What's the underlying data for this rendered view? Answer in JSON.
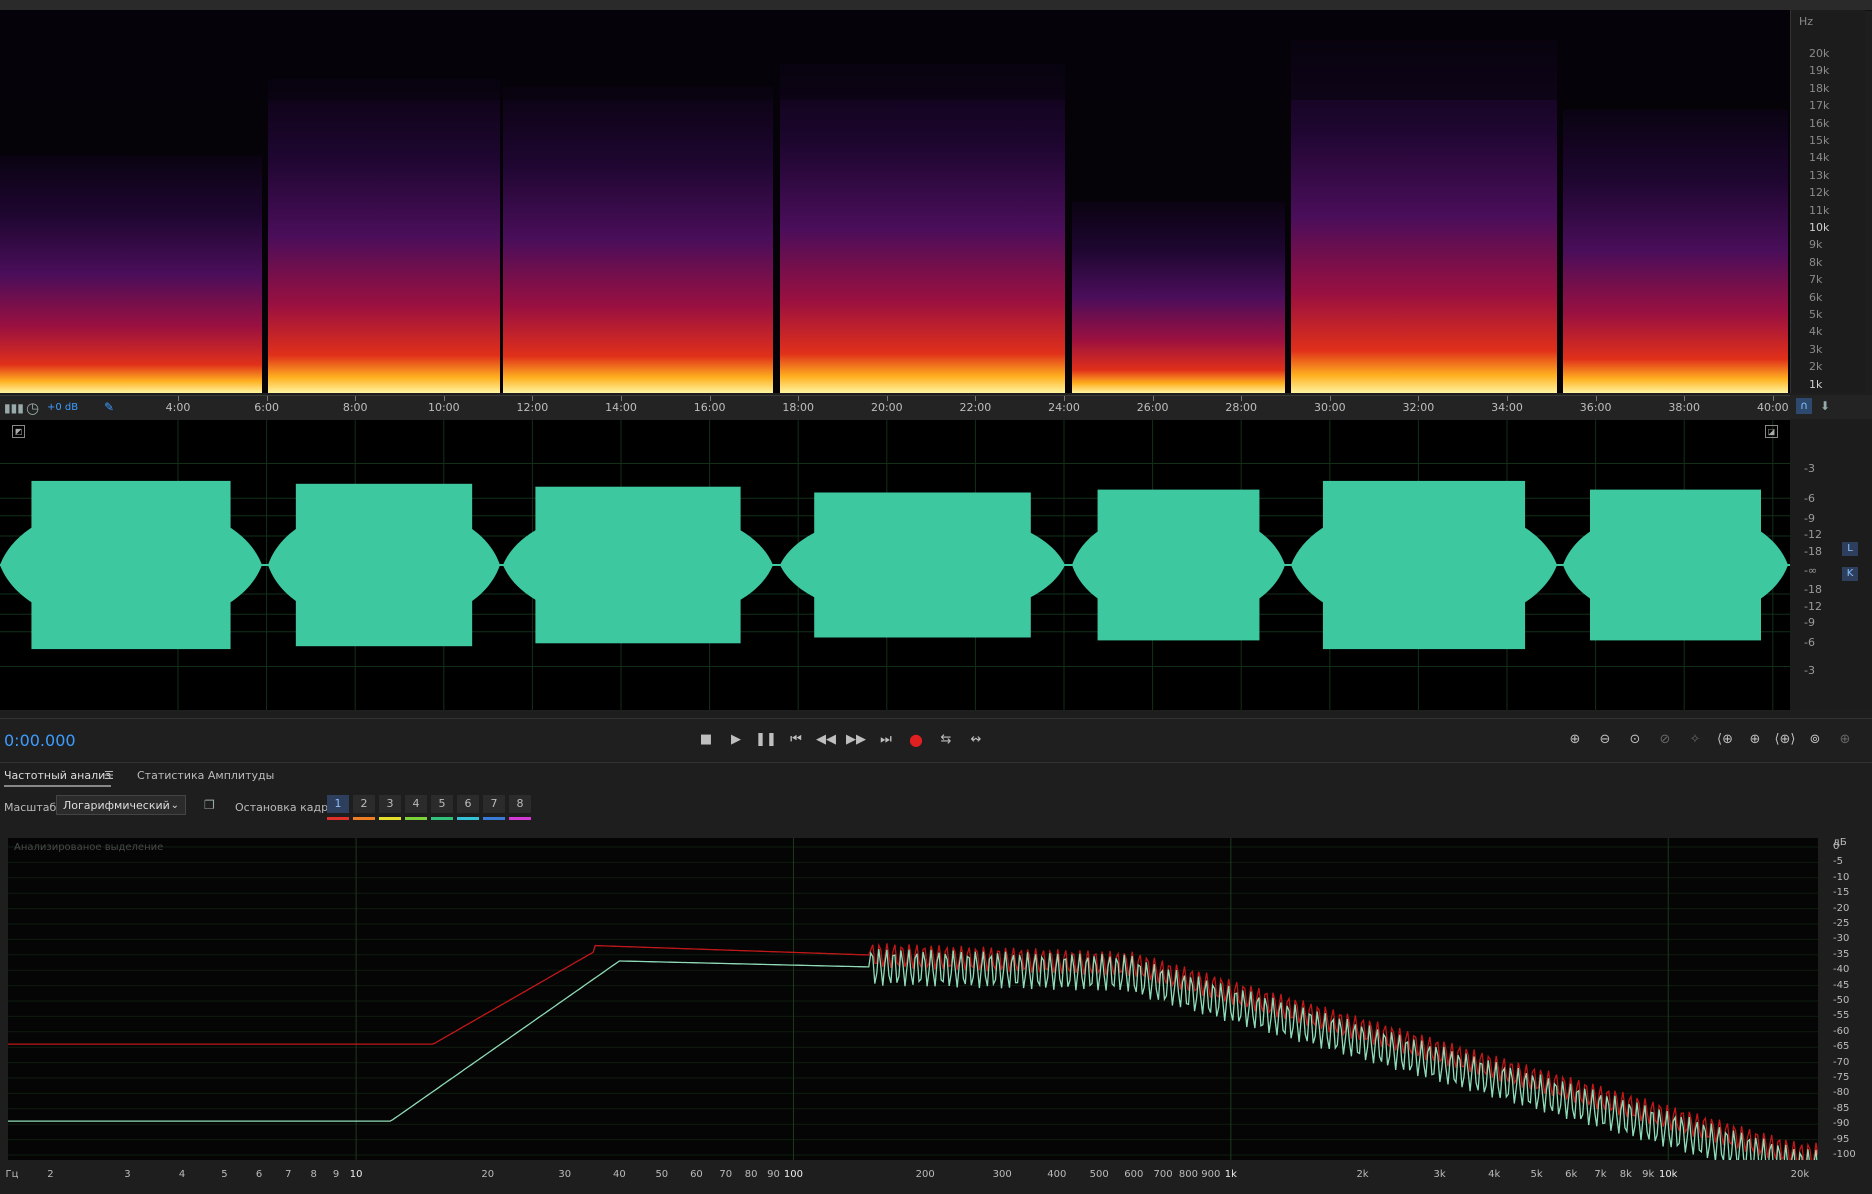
{
  "spectral_scale": {
    "unit": "Hz",
    "ticks": [
      "20k",
      "19k",
      "18k",
      "17k",
      "16k",
      "15k",
      "14k",
      "13k",
      "12k",
      "11k",
      "10k",
      "9k",
      "8k",
      "7k",
      "6k",
      "5k",
      "4k",
      "3k",
      "2k",
      "1k"
    ]
  },
  "timeline": {
    "gain_label": "+0 dB",
    "labels": [
      "4:00",
      "6:00",
      "8:00",
      "10:00",
      "12:00",
      "14:00",
      "16:00",
      "18:00",
      "20:00",
      "22:00",
      "24:00",
      "26:00",
      "28:00",
      "30:00",
      "32:00",
      "34:00",
      "36:00",
      "38:00",
      "40:00"
    ]
  },
  "waveform_scale": {
    "top": [
      "-3",
      "-6",
      "-9",
      "-12",
      "-18"
    ],
    "center": "-∞",
    "bottom": [
      "-18",
      "-12",
      "-9",
      "-6",
      "-3"
    ],
    "channel_top": "L",
    "channel_bottom": "K"
  },
  "transport": {
    "time": "0:00.000"
  },
  "panel": {
    "tab_frequency": "Частотный анализ",
    "tab_amplitude": "Статистика Амплитуды",
    "scale_label": "Масштаб:",
    "scale_value": "Логарифмический",
    "freeze_label": "Остановка кадра:",
    "frames": [
      "1",
      "2",
      "3",
      "4",
      "5",
      "6",
      "7",
      "8"
    ],
    "frame_colors": [
      "#e0302a",
      "#ef7d22",
      "#e6df2c",
      "#7cd43a",
      "#33c27a",
      "#35c2d6",
      "#3a7bd8",
      "#d63ad6"
    ],
    "plot_caption": "Анализированое выделение"
  },
  "freq_axis": {
    "unit": "Гц",
    "labels": [
      "2",
      "3",
      "4",
      "5",
      "6",
      "7",
      "8",
      "9",
      "10",
      "20",
      "30",
      "40",
      "50",
      "60",
      "70",
      "80",
      "90",
      "100",
      "200",
      "300",
      "400",
      "500",
      "600",
      "700",
      "800",
      "900",
      "1k",
      "2k",
      "3k",
      "4k",
      "5k",
      "6k",
      "7k",
      "8k",
      "9k",
      "10k",
      "20k"
    ]
  },
  "freq_db": {
    "unit": "дБ",
    "ticks": [
      "0",
      "-5",
      "-10",
      "-15",
      "-20",
      "-25",
      "-30",
      "-35",
      "-40",
      "-45",
      "-50",
      "-55",
      "-60",
      "-65",
      "-70",
      "-75",
      "-80",
      "-85",
      "-90",
      "-95",
      "-100"
    ]
  },
  "colors": {
    "waveform": "#3ec8a0",
    "curve_red": "#c01818",
    "curve_green": "#8fdcb8",
    "accent": "#3d9dff"
  }
}
